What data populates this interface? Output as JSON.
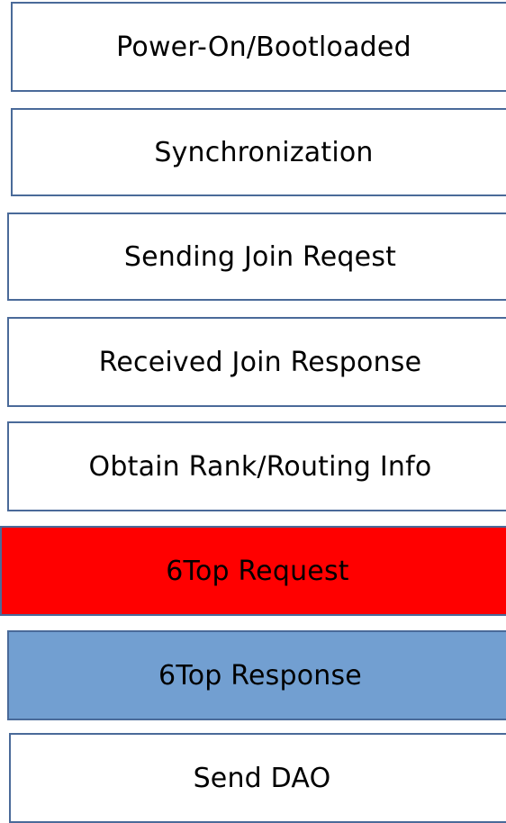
{
  "steps": [
    {
      "label": "Power-On/Bootloaded",
      "fill": "#ffffff"
    },
    {
      "label": "Synchronization",
      "fill": "#ffffff"
    },
    {
      "label": "Sending Join Reqest",
      "fill": "#ffffff"
    },
    {
      "label": "Received Join Response",
      "fill": "#ffffff"
    },
    {
      "label": "Obtain Rank/Routing Info",
      "fill": "#ffffff"
    },
    {
      "label": "6Top Request",
      "fill": "#ff0000"
    },
    {
      "label": "6Top Response",
      "fill": "#729fd1"
    },
    {
      "label": "Send DAO",
      "fill": "#ffffff"
    }
  ],
  "colors": {
    "border": "#4a6a99",
    "text": "#000000"
  }
}
